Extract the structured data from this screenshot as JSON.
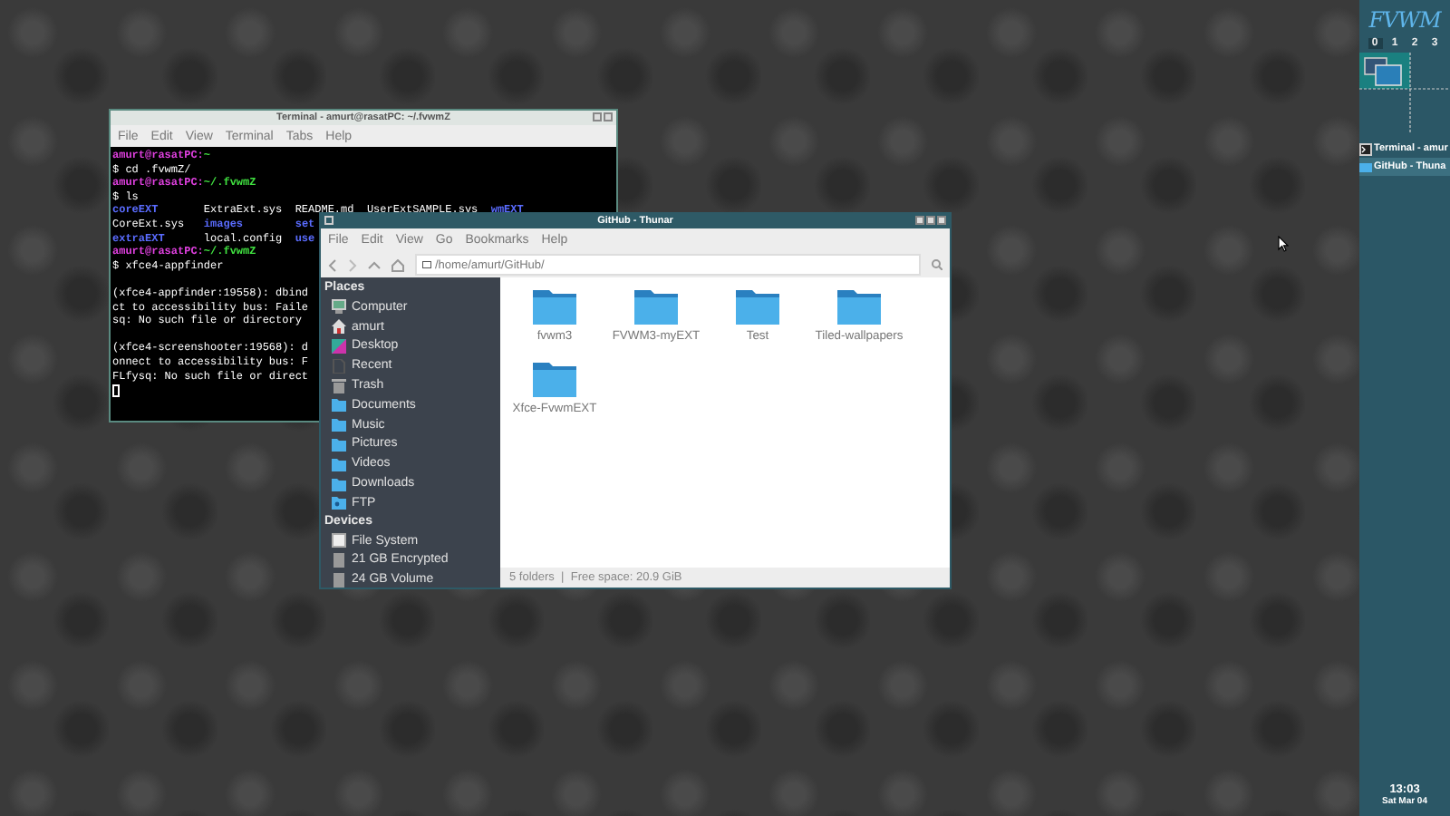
{
  "terminal": {
    "title": "Terminal - amurt@rasatPC: ~/.fvwmZ",
    "menu": [
      "File",
      "Edit",
      "View",
      "Terminal",
      "Tabs",
      "Help"
    ],
    "lines": [
      {
        "kind": "text",
        "parts": [
          {
            "text": "amurt@rasatPC:",
            "kind": "prompt"
          },
          {
            "text": "~",
            "kind": "path"
          }
        ]
      },
      {
        "kind": "text",
        "parts": [
          {
            "text": "$ cd .fvwmZ/",
            "kind": "plain"
          }
        ]
      },
      {
        "kind": "text",
        "parts": [
          {
            "text": "amurt@rasatPC:",
            "kind": "prompt"
          },
          {
            "text": "~/.fvwmZ",
            "kind": "path"
          }
        ]
      },
      {
        "kind": "text",
        "parts": [
          {
            "text": "$ ls",
            "kind": "plain"
          }
        ]
      },
      {
        "kind": "text",
        "parts": [
          {
            "text": "coreEXT",
            "kind": "dir"
          },
          {
            "text": "       ExtraExt.sys  README.md  UserExtSAMPLE.svs  ",
            "kind": "plain"
          },
          {
            "text": "wmEXT",
            "kind": "dir"
          }
        ]
      },
      {
        "kind": "text",
        "parts": [
          {
            "text": "CoreExt.sys   ",
            "kind": "plain"
          },
          {
            "text": "images        ",
            "kind": "dir"
          },
          {
            "text": "set",
            "kind": "dir"
          }
        ]
      },
      {
        "kind": "text",
        "parts": [
          {
            "text": "extraEXT",
            "kind": "dir"
          },
          {
            "text": "      local.config  ",
            "kind": "plain"
          },
          {
            "text": "use",
            "kind": "dir"
          }
        ]
      },
      {
        "kind": "text",
        "parts": [
          {
            "text": "amurt@rasatPC:",
            "kind": "prompt"
          },
          {
            "text": "~/.fvwmZ",
            "kind": "path"
          }
        ]
      },
      {
        "kind": "text",
        "parts": [
          {
            "text": "$ xfce4-appfinder",
            "kind": "plain"
          }
        ]
      },
      {
        "kind": "blank"
      },
      {
        "kind": "text",
        "parts": [
          {
            "text": "(xfce4-appfinder:19558): dbind",
            "kind": "plain"
          }
        ]
      },
      {
        "kind": "text",
        "parts": [
          {
            "text": "ct to accessibility bus: Faile",
            "kind": "plain"
          }
        ]
      },
      {
        "kind": "text",
        "parts": [
          {
            "text": "sq: No such file or directory",
            "kind": "plain"
          }
        ]
      },
      {
        "kind": "blank"
      },
      {
        "kind": "text",
        "parts": [
          {
            "text": "(xfce4-screenshooter:19568): d",
            "kind": "plain"
          }
        ]
      },
      {
        "kind": "text",
        "parts": [
          {
            "text": "onnect to accessibility bus: F",
            "kind": "plain"
          }
        ]
      },
      {
        "kind": "text",
        "parts": [
          {
            "text": "FLfysq: No such file or direct",
            "kind": "plain"
          }
        ]
      }
    ],
    "cursor": true
  },
  "thunar": {
    "title": "GitHub - Thunar",
    "menu": [
      "File",
      "Edit",
      "View",
      "Go",
      "Bookmarks",
      "Help"
    ],
    "path": "/home/amurt/GitHub/",
    "sidebar": [
      {
        "heading": "Places",
        "items": [
          {
            "label": "Computer",
            "kind": "computer"
          },
          {
            "label": "amurt",
            "kind": "home"
          },
          {
            "label": "Desktop",
            "kind": "desktop"
          },
          {
            "label": "Recent",
            "kind": "recent"
          },
          {
            "label": "Trash",
            "kind": "trash"
          },
          {
            "label": "Documents",
            "kind": "folder"
          },
          {
            "label": "Music",
            "kind": "folder"
          },
          {
            "label": "Pictures",
            "kind": "folder"
          },
          {
            "label": "Videos",
            "kind": "folder"
          },
          {
            "label": "Downloads",
            "kind": "folder"
          },
          {
            "label": "FTP",
            "kind": "network"
          }
        ]
      },
      {
        "heading": "Devices",
        "items": [
          {
            "label": "File System",
            "kind": "disk"
          },
          {
            "label": "21 GB Encrypted",
            "kind": "drive"
          },
          {
            "label": "24 GB Volume",
            "kind": "drive"
          }
        ]
      }
    ],
    "folders": [
      "fvwm3",
      "FVWM3-myEXT",
      "Test",
      "Tiled-wallpapers",
      "Xfce-FvwmEXT"
    ],
    "status": "5 folders  |  Free space: 20.9 GiB"
  },
  "panel": {
    "logo": "FVWM",
    "desks": [
      {
        "label": "0",
        "selected": true
      },
      {
        "label": "1",
        "selected": false
      },
      {
        "label": "2",
        "selected": false
      },
      {
        "label": "3",
        "selected": false
      }
    ],
    "tasks": [
      {
        "label": "Terminal - amur",
        "kind": "terminal",
        "selected": false
      },
      {
        "label": "GitHub - Thuna",
        "kind": "files",
        "selected": true
      }
    ],
    "time": "13:03",
    "date": "Sat Mar 04"
  }
}
